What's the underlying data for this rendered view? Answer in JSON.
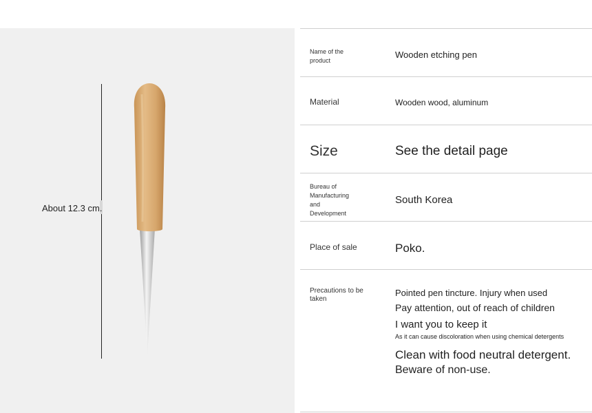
{
  "measure": {
    "label": "About 12.3 cm."
  },
  "specs": {
    "name": {
      "label": "Name of the product",
      "value": "Wooden etching pen"
    },
    "material": {
      "label": "Material",
      "value": "Wooden wood, aluminum"
    },
    "size": {
      "label": "Size",
      "value": "See the detail page"
    },
    "bureau": {
      "label_lines": [
        "Bureau of",
        "Manufacturing",
        "and",
        "Development"
      ],
      "value": "South Korea"
    },
    "place": {
      "label": "Place of sale",
      "value": "Poko."
    },
    "precautions": {
      "label": "Precautions to be taken",
      "lines": [
        "Pointed pen tincture. Injury when used",
        "Pay attention, out of reach of children",
        "I want you to keep it",
        "As it can cause discoloration when using chemical detergents",
        "Clean with food neutral detergent.",
        "Beware of non-use."
      ]
    }
  },
  "colors": {
    "handle": "#d9ad76",
    "metal": "#c8c8c8",
    "panel": "#f0f0f0",
    "divider": "#cfcfcf"
  }
}
